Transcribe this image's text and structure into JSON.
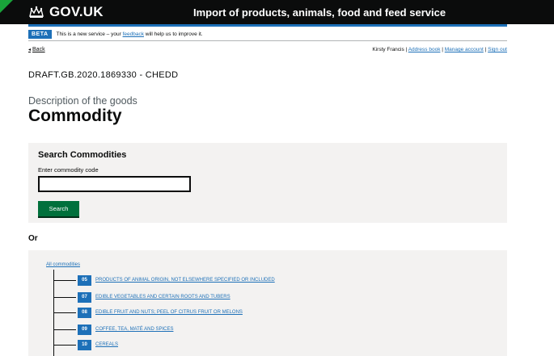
{
  "header": {
    "logo_text": "GOV.UK",
    "service_name": "Import of products, animals, food and feed service",
    "icon": "crown-icon",
    "accent_color": "#1d70b8"
  },
  "beta": {
    "tag": "BETA",
    "text_before": "This is a new service – your ",
    "link": "feedback",
    "text_after": " will help us to improve it."
  },
  "nav": {
    "back": "Back",
    "user_name": "Kirsty Francis",
    "separator": " | ",
    "address_book": "Address book",
    "manage_account": "Manage account",
    "sign_out": "Sign out"
  },
  "reference": "DRAFT.GB.2020.1869330 - CHEDD",
  "page": {
    "caption": "Description of the goods",
    "title": "Commodity"
  },
  "search": {
    "heading": "Search Commodities",
    "label": "Enter commodity code",
    "value": "",
    "button": "Search",
    "button_color": "#00703c"
  },
  "or_label": "Or",
  "tree": {
    "root": "All commodities",
    "items": [
      {
        "code": "05",
        "label": "PRODUCTS OF ANIMAL ORIGIN, NOT ELSEWHERE SPECIFIED OR INCLUDED"
      },
      {
        "code": "07",
        "label": "EDIBLE VEGETABLES AND CERTAIN ROOTS AND TUBERS"
      },
      {
        "code": "08",
        "label": "EDIBLE FRUIT AND NUTS; PEEL OF CITRUS FRUIT OR MELONS"
      },
      {
        "code": "09",
        "label": "COFFEE, TEA, MATÉ AND SPICES"
      },
      {
        "code": "10",
        "label": "CEREALS"
      }
    ]
  }
}
